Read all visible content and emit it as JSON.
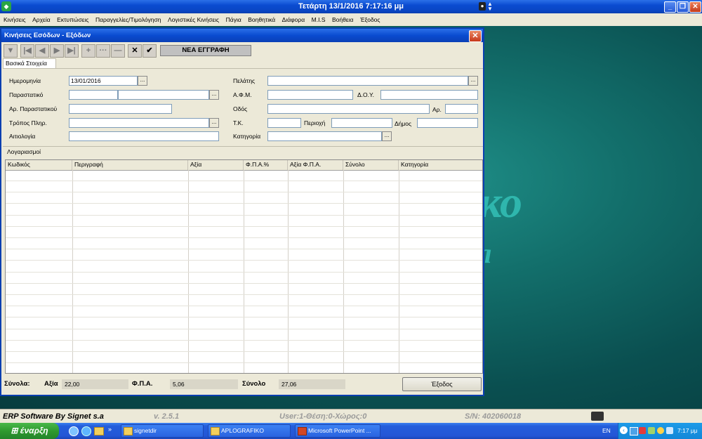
{
  "window": {
    "title": "Τετάρτη   13/1/2016 7:17:16 μμ"
  },
  "menu": [
    "Κινήσεις",
    "Αρχεία",
    "Εκτυπώσεις",
    "Παραγγελίες/Τιμολόγηση",
    "Λογιστικές Κινήσεις",
    "Πάγια",
    "Βοηθητικά",
    "Διάφορα",
    "M.I.S",
    "Βοήθεια",
    "Έξοδος"
  ],
  "background": {
    "big_text": "ко",
    "small_text": "л"
  },
  "dialog": {
    "title": "Κινήσεις Εσόδων - Εξόδων",
    "status_label": "ΝΕΑ ΕΓΓΡΑΦΗ",
    "tab": "Βασικά Στοιχεία",
    "form": {
      "date_label": "Ημερομηνία",
      "date_value": "13/01/2016",
      "doc_label": "Παραστατικό",
      "docnum_label": "Αρ. Παραστατικού",
      "payment_label": "Τρόπος Πληρ.",
      "reason_label": "Αιτιολογία",
      "customer_label": "Πελάτης",
      "afm_label": "Α.Φ.Μ.",
      "doy_label": "Δ.Ο.Υ.",
      "street_label": "Οδός",
      "number_label": "Αρ.",
      "tk_label": "Τ.Κ.",
      "area_label": "Περιοχή",
      "municipality_label": "Δήμος",
      "category_label": "Κατηγορία"
    },
    "grid": {
      "section_label": "Λογαριασμοί",
      "columns": [
        "Κωδικός",
        "Περιγραφή",
        "Αξία",
        "Φ.Π.Α.%",
        "Αξία Φ.Π.Α.",
        "Σύνολο",
        "Κατηγορία"
      ]
    },
    "totals": {
      "label": "Σύνολα:",
      "value_label": "Αξία",
      "value": "22,00",
      "vat_label": "Φ.Π.Α.",
      "vat": "5,06",
      "total_label": "Σύνολο",
      "total": "27,06"
    },
    "exit_label": "Έξοδος"
  },
  "statusbar": {
    "product": "ERP Software By Signet s.a",
    "version": "v. 2.5.1",
    "user": "User:1-Θέση:0-Χώρος:0",
    "serial": "S/N: 402060018"
  },
  "taskbar": {
    "start_label": "έναρξη",
    "tasks": [
      "signetdir",
      "APLOGRAFIKO",
      "Microsoft PowerPoint ..."
    ],
    "lang": "EN",
    "clock": "7:17 μμ"
  },
  "colors": {
    "title_blue": "#0a4bd0",
    "desktop_teal": "#13706c",
    "start_green": "#2f9a2f"
  }
}
